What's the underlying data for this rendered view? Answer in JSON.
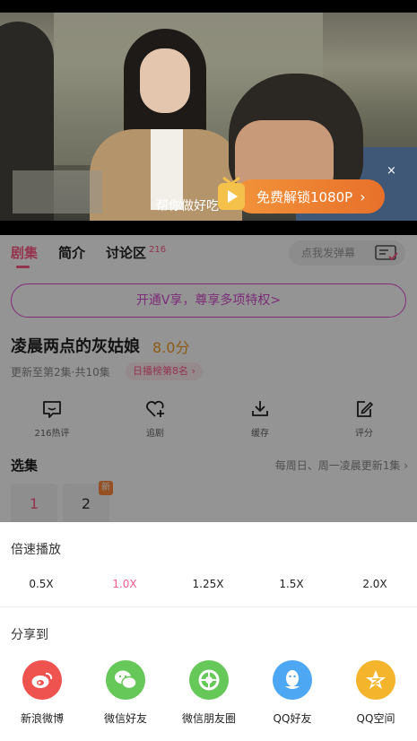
{
  "video": {
    "subtitle": "帮你做好吃",
    "unlock_label": "免费解锁1080P",
    "unlock_arrow": "›",
    "close_label": "×"
  },
  "tabs": [
    {
      "label": "剧集"
    },
    {
      "label": "简介"
    },
    {
      "label": "讨论区",
      "count": "216"
    }
  ],
  "danmaku": {
    "placeholder": "点我发弹幕"
  },
  "vip_banner": "开通V享，尊享多项特权>",
  "show": {
    "title": "凌晨两点的灰姑娘",
    "score": "8.0分",
    "update": "更新至第2集·共10集",
    "rank": "日播榜第8名 ›"
  },
  "actions": [
    {
      "label": "216热评",
      "icon": "comment-icon"
    },
    {
      "label": "追剧",
      "icon": "follow-icon"
    },
    {
      "label": "缓存",
      "icon": "download-icon"
    },
    {
      "label": "评分",
      "icon": "rate-icon"
    }
  ],
  "episodes": {
    "header": "选集",
    "schedule": "每周日、周一凌晨更新1集 ›",
    "items": [
      {
        "label": "1"
      },
      {
        "label": "2",
        "badge": "新"
      }
    ]
  },
  "speed": {
    "title": "倍速播放",
    "options": [
      "0.5X",
      "1.0X",
      "1.25X",
      "1.5X",
      "2.0X"
    ],
    "selected": "1.0X"
  },
  "share": {
    "title": "分享到",
    "targets": [
      {
        "label": "新浪微博",
        "color": "#ef5350",
        "icon": "weibo-icon"
      },
      {
        "label": "微信好友",
        "color": "#67c85a",
        "icon": "wechat-icon"
      },
      {
        "label": "微信朋友圈",
        "color": "#67c85a",
        "icon": "moments-icon"
      },
      {
        "label": "QQ好友",
        "color": "#4da7f2",
        "icon": "qq-icon"
      },
      {
        "label": "QQ空间",
        "color": "#f4b52c",
        "icon": "qzone-icon"
      }
    ]
  },
  "colors": {
    "accent": "#ff5a88",
    "score": "#f39b22",
    "vip": "#d64dcf",
    "unlock": "#ef7e30"
  }
}
